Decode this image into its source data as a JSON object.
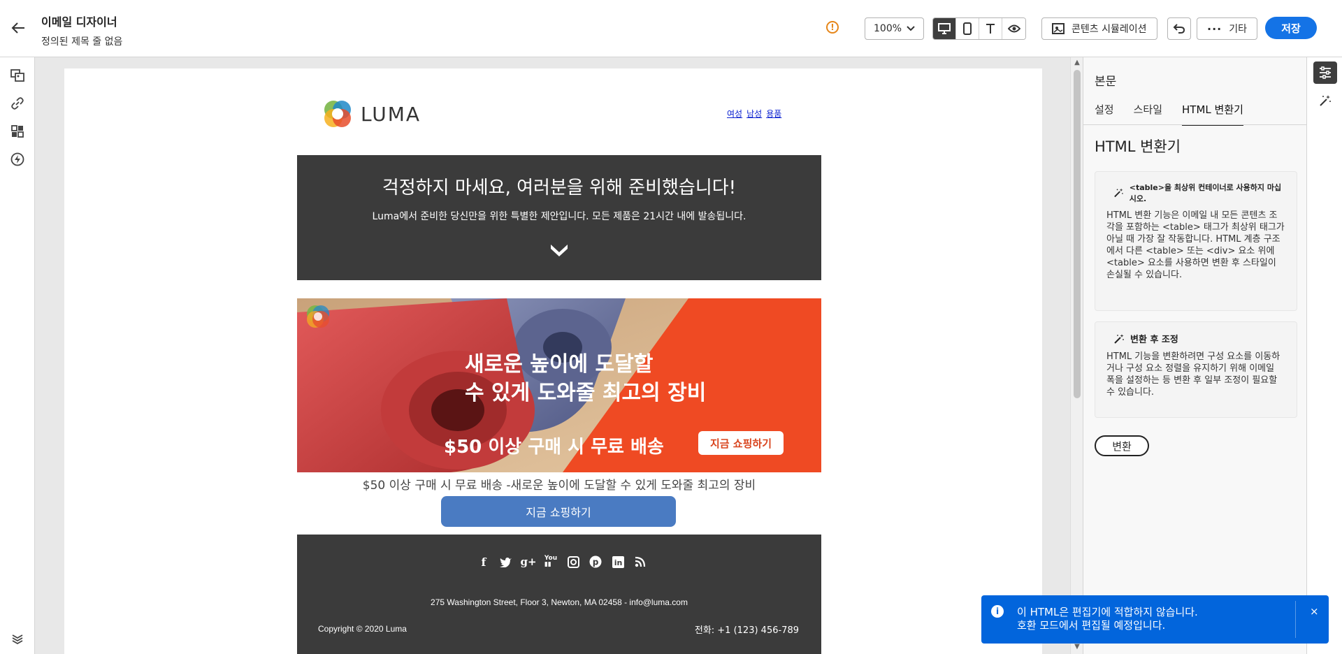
{
  "header": {
    "title": "이메일 디자이너",
    "subtitle": "정의된 제목 줄 없음",
    "zoom_value": "100%",
    "content_sim_label": "콘텐츠 시뮬레이션",
    "more_label": "기타",
    "save_label": "저장"
  },
  "email": {
    "brand": "LUMA",
    "nav": [
      "여성",
      "남성",
      "용품"
    ],
    "hero_title": "걱정하지 마세요, 여러분을 위해 준비했습니다!",
    "hero_text": "Luma에서 준비한 당신만을 위한 특별한 제안입니다. 모든 제품은 21시간 내에 발송됩니다.",
    "banner_line1": "새로운 높이에 도달할",
    "banner_line2": "수 있게 도와줄 최고의 장비",
    "banner_promo": "$50 이상 구매 시 무료 배송",
    "banner_cta": "지금 쇼핑하기",
    "caption": "$50 이상 구매 시 무료 배송 -새로운 높이에 도달할 수 있게 도와줄 최고의 장비",
    "shop_button": "지금 쇼핑하기",
    "social": [
      "f",
      "t",
      "g+",
      "You",
      "ig",
      "p",
      "in",
      "rss"
    ],
    "address": "275 Washington Street, Floor 3, Newton, MA 02458 - info@luma.com",
    "copyright": "Copyright © 2020 Luma",
    "phone": "전화:  +1 (123) 456-789"
  },
  "panel": {
    "header": "본문",
    "tabs": [
      "설정",
      "스타일",
      "HTML 변환기"
    ],
    "active_tab": "HTML 변환기",
    "section_title": "HTML 변환기",
    "card1_title": "<table>을 최상위 컨테이너로 사용하지 마십시오.",
    "card1_body": "HTML 변환 기능은 이메일 내 모든 콘텐츠 조각을 포함하는 <table> 태그가 최상위 태그가 아닐 때 가장 잘 작동합니다.  HTML 계층 구조에서 다른 <table> 또는 <div> 요소 위에 <table> 요소를 사용하면 변환 후 스타일이 손실될 수 있습니다.",
    "card2_title": "변환 후 조정",
    "card2_body": "HTML 기능을 변환하려면 구성 요소를 이동하거나 구성 요소 정렬을 유지하기 위해 이메일 폭을 설정하는 등 변환 후 일부 조정이 필요할 수 있습니다.",
    "convert_label": "변환"
  },
  "toast": {
    "line1": "이 HTML은 편집기에 적합하지 않습니다.",
    "line2": "호환 모드에서 편집될 예정입니다.",
    "close": "×"
  },
  "colors": {
    "accent": "#1473e6",
    "toast_bg": "#0265dc",
    "email_dark": "#3b3b3b",
    "banner_orange": "#d9451f",
    "shop_button": "#4a7bc2"
  }
}
